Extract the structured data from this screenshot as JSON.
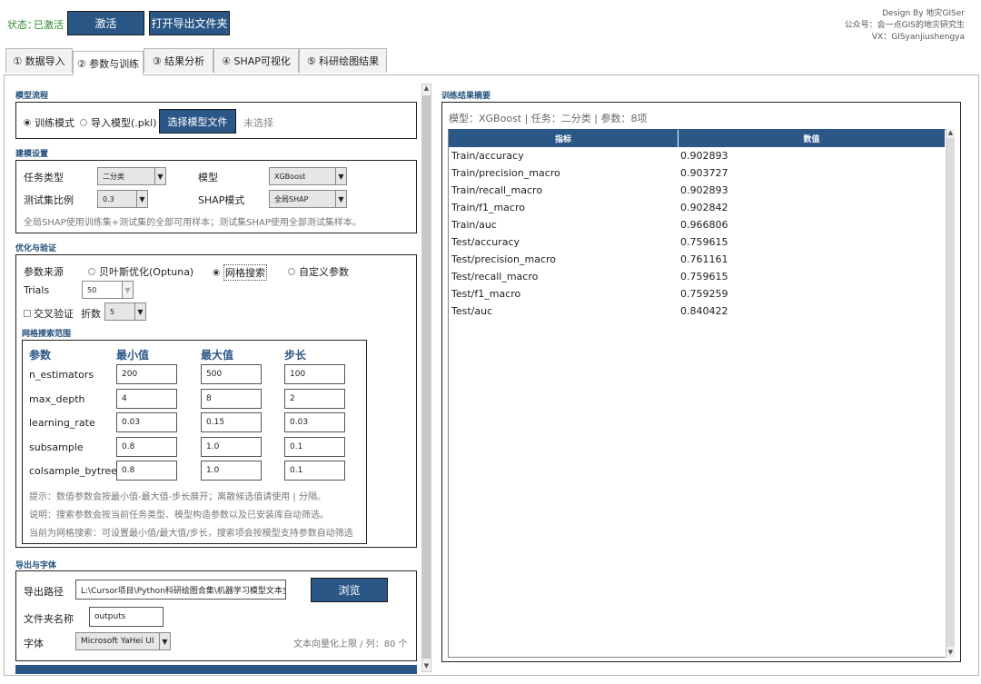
{
  "header": {
    "status_label": "状态：",
    "status_value": "已激活",
    "activate_button": "激活",
    "open_export_button": "打开导出文件夹",
    "credits": {
      "line1": "Design By 地灾GISer",
      "line2": "公众号：会一点GIS的地灾研究生",
      "line3": "VX：GISyanjiushengya"
    }
  },
  "tabs": [
    {
      "label": "① 数据导入"
    },
    {
      "label": "② 参数与训练",
      "active": true
    },
    {
      "label": "③ 结果分析"
    },
    {
      "label": "④ SHAP可视化"
    },
    {
      "label": "⑤ 科研绘图结果"
    }
  ],
  "model_flow": {
    "title": "模型流程",
    "mode_train": "训练模式",
    "mode_import": "导入模型(.pkl)",
    "selected_mode": "train",
    "choose_button": "选择模型文件",
    "file_status": "未选择"
  },
  "model_settings": {
    "title": "建模设置",
    "task_label": "任务类型",
    "task_value": "二分类",
    "model_label": "模型",
    "model_value": "XGBoost",
    "test_ratio_label": "测试集比例",
    "test_ratio_value": "0.3",
    "shap_mode_label": "SHAP模式",
    "shap_mode_value": "全局SHAP",
    "note": "全局SHAP使用训练集+测试集的全部可用样本；测试集SHAP使用全部测试集样本。"
  },
  "optimization": {
    "title": "优化与验证",
    "param_source_label": "参数来源",
    "opt_bayes": "贝叶斯优化(Optuna)",
    "opt_grid": "网格搜索",
    "opt_custom": "自定义参数",
    "selected_source": "grid",
    "trials_label": "Trials",
    "trials_value": "50",
    "cv_label": "交叉验证",
    "cv_checked": false,
    "folds_label": "折数",
    "folds_value": "5"
  },
  "grid_search": {
    "title": "网格搜索范围",
    "headers": [
      "参数",
      "最小值",
      "最大值",
      "步长"
    ],
    "rows": [
      {
        "name": "n_estimators",
        "min": "200",
        "max": "500",
        "step": "100"
      },
      {
        "name": "max_depth",
        "min": "4",
        "max": "8",
        "step": "2"
      },
      {
        "name": "learning_rate",
        "min": "0.03",
        "max": "0.15",
        "step": "0.03"
      },
      {
        "name": "subsample",
        "min": "0.8",
        "max": "1.0",
        "step": "0.1"
      },
      {
        "name": "colsample_bytree",
        "min": "0.8",
        "max": "1.0",
        "step": "0.1"
      }
    ],
    "tip1": "提示：数值参数会按最小值-最大值-步长展开；离散候选值请使用 | 分隔。",
    "tip2": "说明：搜索参数会按当前任务类型、模型构造参数以及已安装库自动筛选。",
    "tip3": "当前为网格搜索：可设置最小值/最大值/步长，搜索项会按模型支持参数自动筛选"
  },
  "export": {
    "title": "导出与字体",
    "path_label": "导出路径",
    "path_value": "L:\\Cursor项目\\Python科研绘图合集\\机器学习模型文本全能训",
    "browse_button": "浏览",
    "folder_label": "文件夹名称",
    "folder_value": "outputs",
    "font_label": "字体",
    "font_value": "Microsoft YaHei UI",
    "vector_limit": "文本向量化上限 / 列：80 个"
  },
  "results": {
    "title": "训练结果摘要",
    "summary": "模型：XGBoost | 任务：二分类 | 参数：8项",
    "col_metric": "指标",
    "col_value": "数值",
    "rows": [
      {
        "metric": "Train/accuracy",
        "value": "0.902893"
      },
      {
        "metric": "Train/precision_macro",
        "value": "0.903727"
      },
      {
        "metric": "Train/recall_macro",
        "value": "0.902893"
      },
      {
        "metric": "Train/f1_macro",
        "value": "0.902842"
      },
      {
        "metric": "Train/auc",
        "value": "0.966806"
      },
      {
        "metric": "Test/accuracy",
        "value": "0.759615"
      },
      {
        "metric": "Test/precision_macro",
        "value": "0.761161"
      },
      {
        "metric": "Test/recall_macro",
        "value": "0.759615"
      },
      {
        "metric": "Test/f1_macro",
        "value": "0.759259"
      },
      {
        "metric": "Test/auc",
        "value": "0.840422"
      }
    ]
  },
  "colors": {
    "accent": "#2b5787",
    "status_green": "#2e8b2e",
    "section_title": "#1f4e79"
  }
}
